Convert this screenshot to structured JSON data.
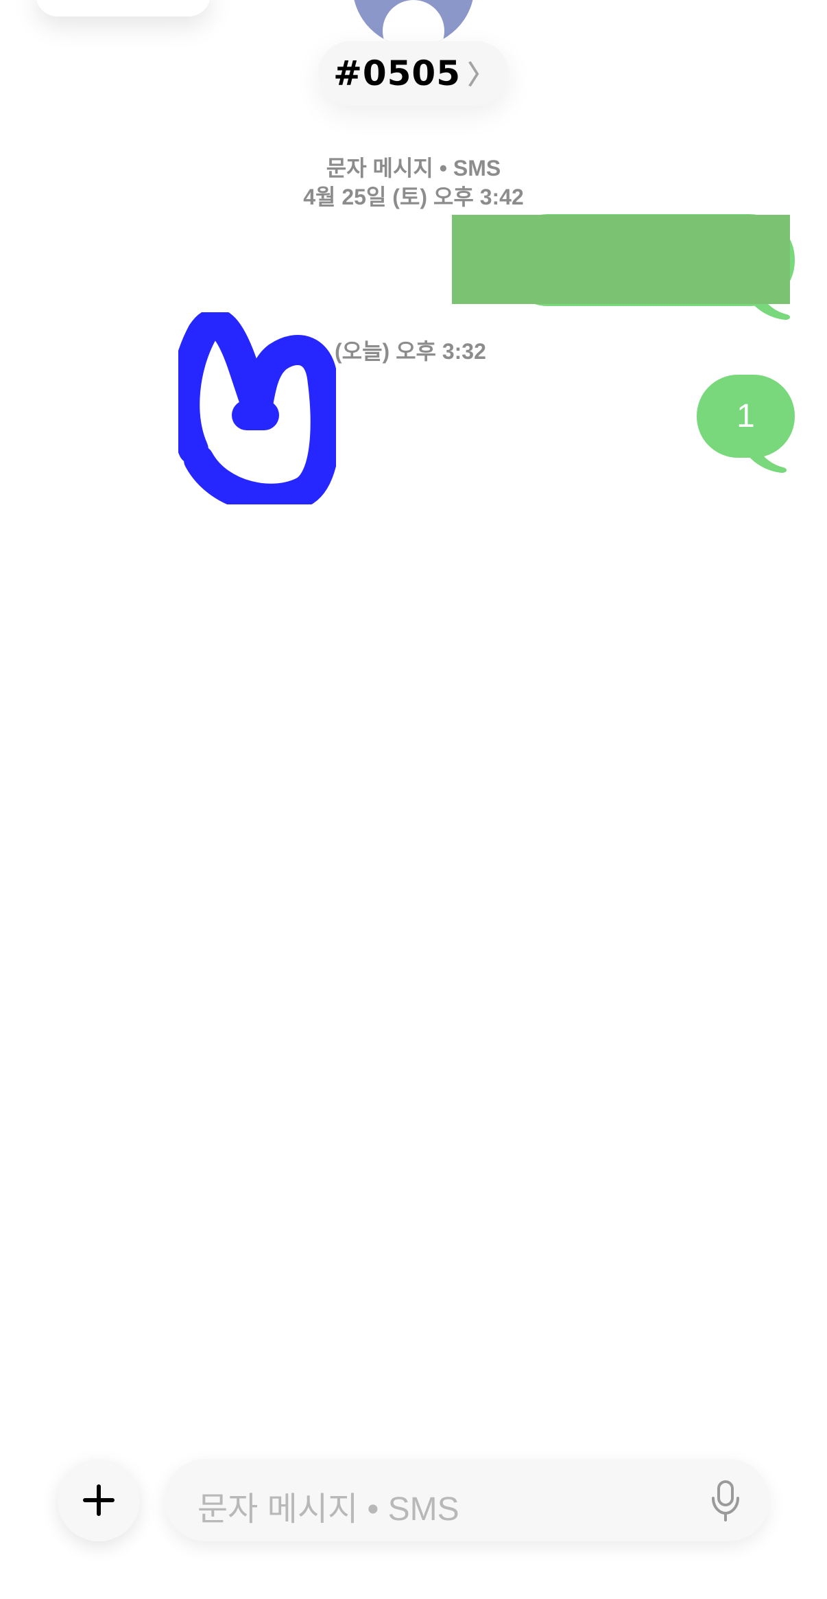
{
  "header": {
    "contact_name": "#0505",
    "chevron": "〉"
  },
  "thread": {
    "meta_line1": "문자 메시지 • SMS",
    "meta_line2": "4월 25일 (토) 오후 3:42",
    "time_divider": "(오늘) 오후 3:32",
    "messages": [
      {
        "direction": "sent",
        "text": ""
      },
      {
        "direction": "sent",
        "text": "1"
      }
    ]
  },
  "composer": {
    "placeholder": "문자 메시지 • SMS"
  },
  "icons": {
    "add": "plus-icon",
    "mic": "microphone-icon",
    "avatar": "person-icon"
  },
  "colors": {
    "sent_bubble": "#78d87b",
    "redaction": "#7cc273",
    "scribble": "#0000ff",
    "avatar_bg": "#8b97c9"
  }
}
